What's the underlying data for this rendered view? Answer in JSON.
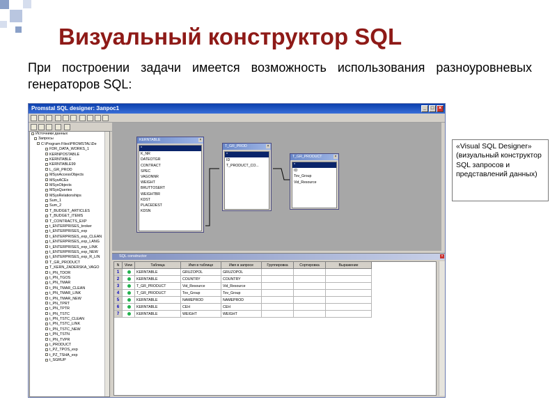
{
  "slide": {
    "title": "Визуальный конструктор SQL",
    "subtitle": "При построении задачи имеется возможность использования разноуровневых генераторов SQL:",
    "callout": "«Visual SQL Designer» (визуальный конструктор SQL запросов и представлений данных)"
  },
  "window": {
    "title": "Promstal SQL designer: Запрос1",
    "buttons": [
      "_",
      "□",
      "×"
    ]
  },
  "tree": {
    "items": [
      "Источники данных",
      "Запросы",
      "C:\\Program Files\\PROMSTAL\\De",
      "FDR_DATA_WORKS_1",
      "KERNPOSTABLE",
      "KERNTABLE",
      "KERNTABLE99",
      "L_GR_PROD",
      "MSysAccessObjects",
      "MSysACEs",
      "MSysObjects",
      "MSysQueries",
      "MSysRelationships",
      "Sum_1",
      "Sum_2",
      "T_BUDGET_ARTICLES",
      "T_BUDGET_ITEMS",
      "T_CONTRACTS_EXP",
      "t_ENTERPRISES_broker",
      "t_ENTERPRISES_exp",
      "t_ENTERPRISES_exp_CLEAN",
      "t_ENTERPRISES_exp_LANG",
      "t_ENTERPRISES_exp_LINK",
      "t_ENTERPRISES_exp_NEW",
      "t_ENTERPRISES_exp_R_LIN",
      "T_GR_PRODUCT",
      "T_KERN_ZADERSKA_VAGO",
      "t_PN_TDOR",
      "t_PN_TGOS",
      "t_PN_TMAR",
      "t_PN_TMAR_CLEAN",
      "t_PN_TMAR_LINK",
      "t_PN_TMAR_NEW",
      "t_PN_TPRT",
      "t_PN_TPTR",
      "t_PN_TSTC",
      "t_PN_TSTC_CLEAN",
      "t_PN_TSTC_LINK",
      "t_PN_TSTC_NEW",
      "t_PN_TSTN",
      "t_PN_TVPR",
      "t_PRODUCT",
      "t_PZ_TPOS_exp",
      "t_PZ_TSHA_exp",
      "t_SGRUP"
    ]
  },
  "tables": [
    {
      "title": "KERNTABLE",
      "fields": [
        "*",
        "K_NR",
        "DATEOTGR",
        "CONTRACT",
        "SPEC",
        "VAGONNR",
        "WEIGHT",
        "BRUTTOSERT",
        "WEIGHTBR",
        "KDST",
        "PLACEDEST",
        "KDSN"
      ],
      "selected": 0
    },
    {
      "title": "T_GR_PROD",
      "fields": [
        "*",
        "ID",
        "T_PRODUCT_CO..."
      ],
      "selected": 0
    },
    {
      "title": "T_GR_PRODUCT",
      "fields": [
        "*",
        "ID",
        "Tov_Group",
        "Vid_Resource"
      ],
      "selected": 0
    }
  ],
  "sql_constructor": {
    "title": "SQL constructor",
    "columns": [
      "N",
      "View",
      "Таблица",
      "Имя в таблице",
      "Имя в запросе",
      "Группировка",
      "Сортировка",
      "Выражение"
    ],
    "rows": [
      {
        "n": "1",
        "table": "KERNTABLE",
        "field": "GRUZOPOL",
        "alias": "GRUZOPOL",
        "group": "",
        "sort": "",
        "expr": ""
      },
      {
        "n": "2",
        "table": "KERNTABLE",
        "field": "COUNTRY",
        "alias": "COUNTRY",
        "group": "",
        "sort": "",
        "expr": ""
      },
      {
        "n": "3",
        "table": "T_GR_PRODUCT",
        "field": "Vid_Resource",
        "alias": "Vid_Resource",
        "group": "",
        "sort": "",
        "expr": ""
      },
      {
        "n": "4",
        "table": "T_GR_PRODUCT",
        "field": "Tov_Group",
        "alias": "Tov_Group",
        "group": "",
        "sort": "",
        "expr": ""
      },
      {
        "n": "5",
        "table": "KERNTABLE",
        "field": "NAMEPROD",
        "alias": "NAMEPROD",
        "group": "",
        "sort": "",
        "expr": ""
      },
      {
        "n": "6",
        "table": "KERNTABLE",
        "field": "CEH",
        "alias": "CEH",
        "group": "",
        "sort": "",
        "expr": ""
      },
      {
        "n": "7",
        "table": "KERNTABLE",
        "field": "WEIGHT",
        "alias": "WEIGHT",
        "group": "",
        "sort": "",
        "expr": ""
      }
    ]
  },
  "colors": {
    "title": "#8e1a17",
    "window_titlebar": "#0b3fae",
    "designer_canvas": "#a7a7a7",
    "view_dot": "#22b14c"
  }
}
